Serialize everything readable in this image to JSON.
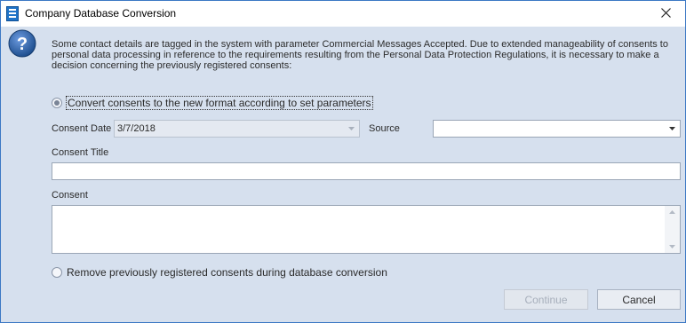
{
  "window": {
    "title": "Company Database Conversion",
    "icons": {
      "app": "database-icon",
      "close": "close-icon",
      "help": "question-icon"
    }
  },
  "message": "Some contact details are tagged in the system with parameter Commercial Messages Accepted. Due to extended manageability of consents to personal data processing in reference to the requirements resulting from the Personal Data Protection Regulations, it is necessary to make a decision concerning the previously registered consents:",
  "options": {
    "convert_label": "Convert consents to the new format according to set parameters",
    "convert_selected": true,
    "remove_label": "Remove previously registered consents during database conversion",
    "remove_selected": false
  },
  "form": {
    "consent_date_label": "Consent Date",
    "consent_date_value": "3/7/2018",
    "source_label": "Source",
    "source_value": "",
    "consent_title_label": "Consent Title",
    "consent_title_value": "",
    "consent_label": "Consent",
    "consent_value": ""
  },
  "buttons": {
    "continue_label": "Continue",
    "continue_enabled": false,
    "cancel_label": "Cancel"
  },
  "colors": {
    "background": "#d6e0ee",
    "border": "#3c78c4",
    "help_icon": "#2f5f9e"
  }
}
